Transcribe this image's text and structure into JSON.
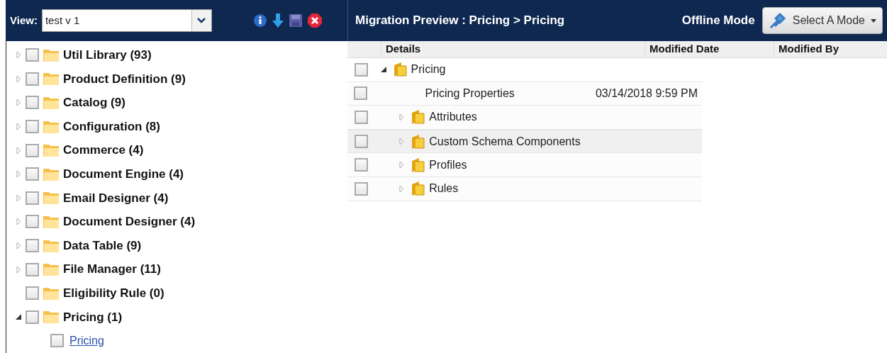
{
  "left_header": {
    "view_label": "View:",
    "view_value": "test v 1"
  },
  "tree": [
    {
      "label": "Util Library (93)",
      "checked": false,
      "expanded": false
    },
    {
      "label": "Product Definition (9)",
      "checked": false,
      "expanded": false
    },
    {
      "label": "Catalog (9)",
      "checked": false,
      "expanded": false
    },
    {
      "label": "Configuration (8)",
      "checked": false,
      "expanded": false
    },
    {
      "label": "Commerce (4)",
      "checked": false,
      "expanded": false
    },
    {
      "label": "Document Engine (4)",
      "checked": false,
      "expanded": false
    },
    {
      "label": "Email Designer (4)",
      "checked": false,
      "expanded": false
    },
    {
      "label": "Document Designer (4)",
      "checked": false,
      "expanded": false
    },
    {
      "label": "Data Table (9)",
      "checked": false,
      "expanded": false
    },
    {
      "label": "File Manager (11)",
      "checked": false,
      "expanded": false
    },
    {
      "label": "Eligibility Rule (0)",
      "checked": false
    },
    {
      "label": "Pricing (1)",
      "checked": false,
      "expanded": true,
      "children": [
        {
          "label": "Pricing",
          "checked": false,
          "kind": "link"
        }
      ]
    }
  ],
  "right_header": {
    "title": "Migration Preview : Pricing > Pricing",
    "mode_label": "Offline Mode",
    "mode_button": "Select A Mode"
  },
  "grid": {
    "columns": [
      "Details",
      "Modified Date",
      "Modified By"
    ],
    "rows": [
      {
        "kind": "folder",
        "details": "Pricing",
        "checked": false,
        "selected": false,
        "expanded": true,
        "children": [
          {
            "kind": "property",
            "details": "Pricing Properties",
            "modified_date": "03/14/2018 9:59 PM",
            "checked": false,
            "selected": false
          },
          {
            "kind": "folder",
            "details": "Attributes",
            "checked": false,
            "selected": false,
            "expanded": false
          },
          {
            "kind": "folder",
            "details": "Custom Schema Components",
            "checked": false,
            "selected": true,
            "expanded": false
          },
          {
            "kind": "folder",
            "details": "Profiles",
            "checked": false,
            "selected": false,
            "expanded": false
          },
          {
            "kind": "folder",
            "details": "Rules",
            "checked": false,
            "selected": false,
            "expanded": false
          }
        ]
      }
    ]
  }
}
